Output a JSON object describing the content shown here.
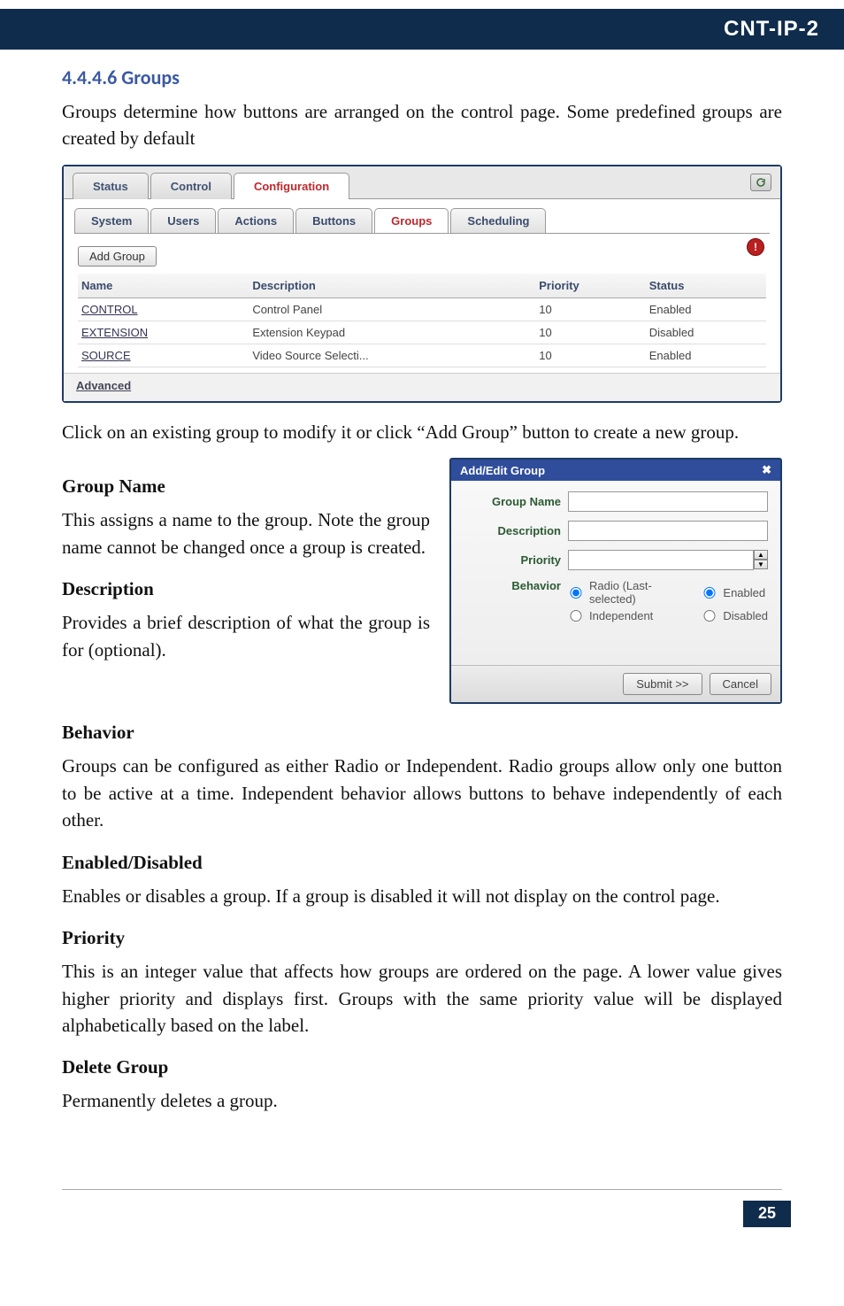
{
  "header": {
    "product": "CNT-IP-2"
  },
  "section": {
    "number_title": "4.4.4.6 Groups",
    "intro": "Groups determine how buttons are arranged on the control page. Some predefined groups are created by default",
    "click_hint": "Click on an existing group to modify it or click “Add Group” button to create a new group.",
    "group_name_h": "Group Name",
    "group_name_p": "This assigns a name to the group. Note the group name cannot be changed once a group is created.",
    "description_h": "Description",
    "description_p": "Provides a brief description of what the group is for (optional).",
    "behavior_h": "Behavior",
    "behavior_p": "Groups can be configured as either Radio or Independent. Radio groups allow only one button to be active at a time. Independent behavior allows buttons to behave independently of each other.",
    "enabled_h": "Enabled/Disabled",
    "enabled_p": "Enables or disables a group. If a group is disabled it will not display on the control page.",
    "priority_h": "Priority",
    "priority_p": "This is an integer value that affects how groups are ordered on the page. A lower value gives higher priority and displays first. Groups with the same priority value will be displayed alphabetically based on the label.",
    "delete_h": "Delete Group",
    "delete_p": "Permanently deletes a group."
  },
  "footer": {
    "page": "25"
  },
  "config_panel": {
    "top_tabs": {
      "status": "Status",
      "control": "Control",
      "configuration": "Configuration"
    },
    "sub_tabs": {
      "system": "System",
      "users": "Users",
      "actions": "Actions",
      "buttons": "Buttons",
      "groups": "Groups",
      "scheduling": "Scheduling"
    },
    "info_dot": "!",
    "add_group_btn": "Add Group",
    "columns": {
      "name": "Name",
      "description": "Description",
      "priority": "Priority",
      "status": "Status"
    },
    "rows": [
      {
        "name": "CONTROL",
        "desc": "Control Panel",
        "priority": "10",
        "status": "Enabled"
      },
      {
        "name": "EXTENSION",
        "desc": "Extension Keypad",
        "priority": "10",
        "status": "Disabled"
      },
      {
        "name": "SOURCE",
        "desc": "Video Source Selecti...",
        "priority": "10",
        "status": "Enabled"
      }
    ],
    "advanced": "Advanced"
  },
  "dialog": {
    "title": "Add/Edit Group",
    "close": "✖",
    "labels": {
      "group_name": "Group Name",
      "description": "Description",
      "priority": "Priority",
      "behavior": "Behavior"
    },
    "values": {
      "group_name": "",
      "description": "",
      "priority": ""
    },
    "behavior_opts": {
      "radio": "Radio (Last-selected)",
      "independent": "Independent",
      "enabled": "Enabled",
      "disabled": "Disabled"
    },
    "buttons": {
      "submit": "Submit >>",
      "cancel": "Cancel"
    }
  }
}
